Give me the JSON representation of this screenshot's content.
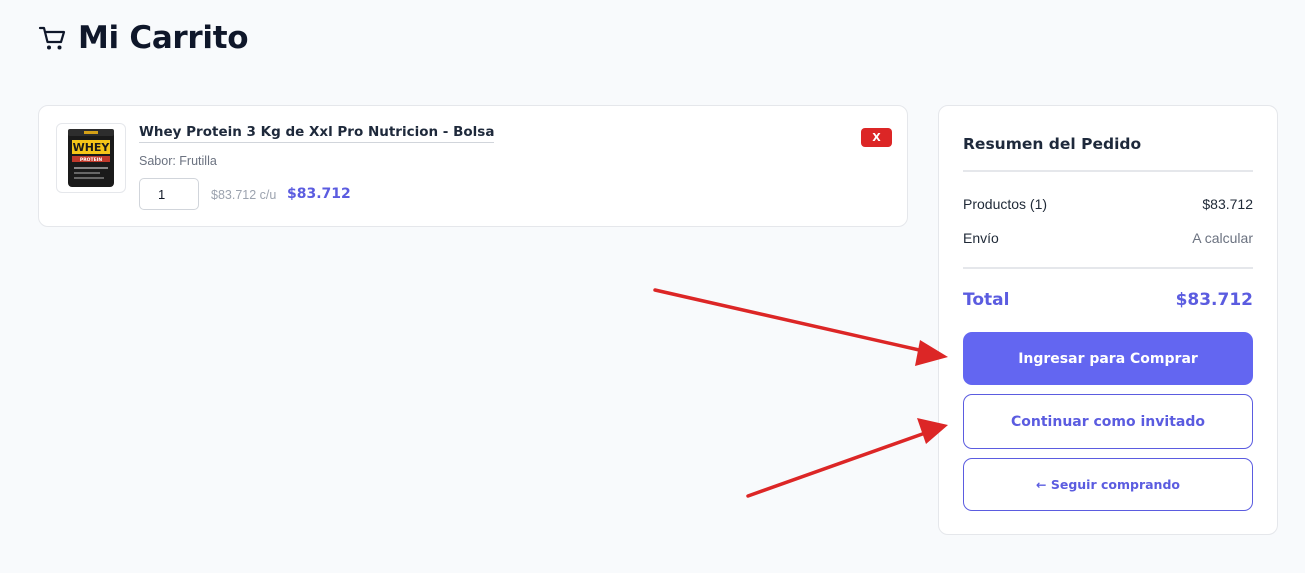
{
  "header": {
    "title": "Mi Carrito",
    "icon": "shopping-cart-icon"
  },
  "cart": {
    "items": [
      {
        "name": "Whey Protein 3 Kg de Xxl Pro Nutricion - Bolsa",
        "flavor": "Sabor: Frutilla",
        "quantity": "1",
        "unit_price": "$83.712 c/u",
        "line_total": "$83.712",
        "remove_label": "X",
        "thumbnail": {
          "label": "WHEY",
          "sublabel": "PROTEIN"
        }
      }
    ]
  },
  "summary": {
    "title": "Resumen del Pedido",
    "products_label": "Productos (1)",
    "products_value": "$83.712",
    "shipping_label": "Envío",
    "shipping_value": "A calcular",
    "total_label": "Total",
    "total_value": "$83.712",
    "login_button": "Ingresar para Comprar",
    "guest_button": "Continuar como invitado",
    "continue_button": "← Seguir comprando"
  },
  "colors": {
    "accent": "#6366f1",
    "accent_text": "#5b5ce0",
    "danger": "#dc2626",
    "annotation_arrow": "#dc2626",
    "background": "#f8fafc"
  }
}
